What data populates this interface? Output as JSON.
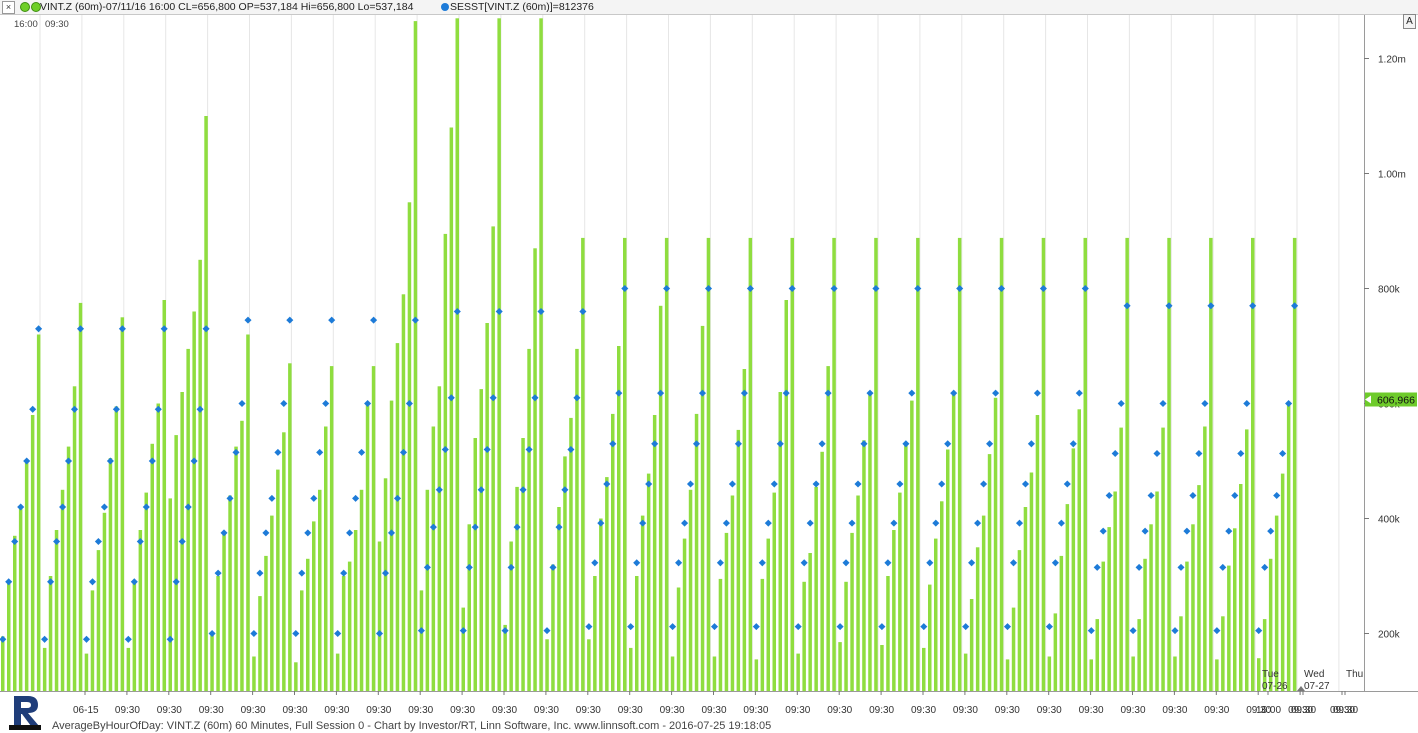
{
  "header": {
    "close_glyph": "×",
    "legend_main": "VINT.Z (60m)-07/11/16 16:00 CL=656,800 OP=537,184 Hi=656,800 Lo=537,184",
    "legend_indicator": "SESST[VINT.Z (60m)]=812376",
    "auto_button": "A"
  },
  "colors": {
    "bar": "#8fdd3f",
    "marker": "#1d7bd8",
    "grid": "#e6e6e6",
    "price_box": "#6ecb2b"
  },
  "top_labels": [
    "16:00",
    "09:30"
  ],
  "footer_text": "AverageByHourOfDay: VINT.Z (60m) 60 Minutes, Full Session 0 - Chart by Investor/RT, Linn Software, Inc. www.linnsoft.com - 2016-07-25 19:18:05",
  "chart_data": {
    "type": "bar",
    "series_name": "VINT.Z (60m)",
    "y_axis": {
      "ticks": [
        200000,
        400000,
        600000,
        800000,
        1000000,
        1200000
      ],
      "tick_labels": [
        "200k",
        "400k",
        "600k",
        "800k",
        "1.00m",
        "1.20m"
      ],
      "ylim": [
        100000,
        1270000
      ]
    },
    "last_value_label": "606,966",
    "x_tick_labels": [
      "06-15",
      "09:30",
      "09:30",
      "09:30",
      "09:30",
      "09:30",
      "09:30",
      "09:30",
      "09:30",
      "09:30",
      "09:30",
      "09:30",
      "09:30",
      "09:30",
      "09:30",
      "09:30",
      "09:30",
      "09:30",
      "09:30",
      "09:30",
      "09:30",
      "09:30",
      "09:30",
      "09:30",
      "09:30",
      "09:30",
      "09:30",
      "09:30",
      "09:30",
      "09:30",
      "09:30",
      "16:00",
      "09:30",
      "09:30"
    ],
    "future_day_labels": [
      {
        "day": "Tue",
        "date": "07-26"
      },
      {
        "day": "Wed",
        "date": "07-27"
      },
      {
        "day": "Thu",
        "date": ""
      }
    ],
    "sessions": [
      {
        "bars": [
          195000,
          290000,
          370000,
          420000,
          500000,
          580000,
          720000
        ],
        "markers": [
          190000,
          290000,
          360000,
          420000,
          500000,
          590000,
          730000
        ]
      },
      {
        "bars": [
          175000,
          300000,
          380000,
          450000,
          525000,
          630000,
          775000
        ],
        "markers": [
          190000,
          290000,
          360000,
          420000,
          500000,
          590000,
          730000
        ]
      },
      {
        "bars": [
          165000,
          275000,
          345000,
          410000,
          505000,
          595000,
          750000
        ],
        "markers": [
          190000,
          290000,
          360000,
          420000,
          500000,
          590000,
          730000
        ]
      },
      {
        "bars": [
          175000,
          290000,
          380000,
          445000,
          530000,
          600000,
          780000
        ],
        "markers": [
          190000,
          290000,
          360000,
          420000,
          500000,
          590000,
          730000
        ]
      },
      {
        "bars": [
          435000,
          545000,
          620000,
          695000,
          760000,
          850000,
          1100000
        ],
        "markers": [
          190000,
          290000,
          360000,
          420000,
          500000,
          590000,
          730000
        ]
      },
      {
        "bars": [
          200000,
          300000,
          375000,
          440000,
          525000,
          570000,
          720000
        ],
        "markers": [
          200000,
          305000,
          375000,
          435000,
          515000,
          600000,
          745000
        ]
      },
      {
        "bars": [
          160000,
          265000,
          335000,
          405000,
          485000,
          550000,
          670000
        ],
        "markers": [
          200000,
          305000,
          375000,
          435000,
          515000,
          600000,
          745000
        ]
      },
      {
        "bars": [
          150000,
          275000,
          330000,
          395000,
          450000,
          560000,
          665000
        ],
        "markers": [
          200000,
          305000,
          375000,
          435000,
          515000,
          600000,
          745000
        ]
      },
      {
        "bars": [
          165000,
          300000,
          325000,
          380000,
          450000,
          600000,
          665000
        ],
        "markers": [
          200000,
          305000,
          375000,
          435000,
          515000,
          600000,
          745000
        ]
      },
      {
        "bars": [
          360000,
          470000,
          605000,
          705000,
          790000,
          950000,
          1265000
        ],
        "markers": [
          200000,
          305000,
          375000,
          435000,
          515000,
          600000,
          745000
        ]
      },
      {
        "bars": [
          275000,
          450000,
          560000,
          630000,
          895000,
          1080000,
          1285000
        ],
        "markers": [
          205000,
          315000,
          385000,
          450000,
          520000,
          610000,
          760000
        ]
      },
      {
        "bars": [
          245000,
          390000,
          540000,
          625000,
          740000,
          908000,
          1285000
        ],
        "markers": [
          205000,
          315000,
          385000,
          450000,
          520000,
          610000,
          760000
        ]
      },
      {
        "bars": [
          215000,
          360000,
          455000,
          540000,
          695000,
          870000,
          1285000
        ],
        "markers": [
          205000,
          315000,
          385000,
          450000,
          520000,
          610000,
          760000
        ]
      },
      {
        "bars": [
          190000,
          320000,
          420000,
          508000,
          575000,
          695000,
          888000
        ],
        "markers": [
          205000,
          315000,
          385000,
          450000,
          520000,
          610000,
          760000
        ]
      },
      {
        "bars": [
          190000,
          300000,
          400000,
          472000,
          582000,
          700000,
          888000
        ],
        "markers": [
          212000,
          323000,
          392000,
          460000,
          530000,
          618000,
          800000
        ]
      },
      {
        "bars": [
          175000,
          300000,
          405000,
          478000,
          580000,
          770000,
          888000
        ],
        "markers": [
          212000,
          323000,
          392000,
          460000,
          530000,
          618000,
          800000
        ]
      },
      {
        "bars": [
          160000,
          280000,
          365000,
          450000,
          582000,
          735000,
          888000
        ],
        "markers": [
          212000,
          323000,
          392000,
          460000,
          530000,
          618000,
          800000
        ]
      },
      {
        "bars": [
          160000,
          295000,
          375000,
          440000,
          554000,
          660000,
          888000
        ],
        "markers": [
          212000,
          323000,
          392000,
          460000,
          530000,
          618000,
          800000
        ]
      },
      {
        "bars": [
          155000,
          295000,
          365000,
          445000,
          620000,
          780000,
          888000
        ],
        "markers": [
          212000,
          323000,
          392000,
          460000,
          530000,
          618000,
          800000
        ]
      },
      {
        "bars": [
          165000,
          290000,
          340000,
          455000,
          516000,
          665000,
          888000
        ],
        "markers": [
          212000,
          323000,
          392000,
          460000,
          530000,
          618000,
          800000
        ]
      },
      {
        "bars": [
          185000,
          290000,
          375000,
          440000,
          536000,
          620000,
          888000
        ],
        "markers": [
          212000,
          323000,
          392000,
          460000,
          530000,
          618000,
          800000
        ]
      },
      {
        "bars": [
          180000,
          300000,
          380000,
          445000,
          527000,
          605000,
          888000
        ],
        "markers": [
          212000,
          323000,
          392000,
          460000,
          530000,
          618000,
          800000
        ]
      },
      {
        "bars": [
          175000,
          285000,
          365000,
          430000,
          520000,
          620000,
          888000
        ],
        "markers": [
          212000,
          323000,
          392000,
          460000,
          530000,
          618000,
          800000
        ]
      },
      {
        "bars": [
          165000,
          260000,
          350000,
          405000,
          512000,
          610000,
          888000
        ],
        "markers": [
          212000,
          323000,
          392000,
          460000,
          530000,
          618000,
          800000
        ]
      },
      {
        "bars": [
          155000,
          245000,
          345000,
          420000,
          480000,
          580000,
          888000
        ],
        "markers": [
          212000,
          323000,
          392000,
          460000,
          530000,
          618000,
          800000
        ]
      },
      {
        "bars": [
          160000,
          235000,
          335000,
          425000,
          522000,
          590000,
          888000
        ],
        "markers": [
          212000,
          323000,
          392000,
          460000,
          530000,
          618000,
          800000
        ]
      },
      {
        "bars": [
          155000,
          225000,
          325000,
          385000,
          447000,
          558000,
          888000
        ],
        "markers": [
          205000,
          315000,
          378000,
          440000,
          513000,
          600000,
          770000
        ]
      },
      {
        "bars": [
          160000,
          225000,
          330000,
          390000,
          447000,
          558000,
          888000
        ],
        "markers": [
          205000,
          315000,
          378000,
          440000,
          513000,
          600000,
          770000
        ]
      },
      {
        "bars": [
          160000,
          230000,
          325000,
          390000,
          458000,
          560000,
          888000
        ],
        "markers": [
          205000,
          315000,
          378000,
          440000,
          513000,
          600000,
          770000
        ]
      },
      {
        "bars": [
          155000,
          230000,
          318000,
          383000,
          460000,
          555000,
          888000
        ],
        "markers": [
          205000,
          315000,
          378000,
          440000,
          513000,
          600000,
          770000
        ]
      },
      {
        "bars": [
          157000,
          225000,
          330000,
          405000,
          478000,
          597000,
          888000
        ],
        "markers": [
          205000,
          315000,
          378000,
          440000,
          513000,
          600000,
          770000
        ]
      }
    ],
    "marker_series": "SESST[VINT.Z (60m)]"
  }
}
